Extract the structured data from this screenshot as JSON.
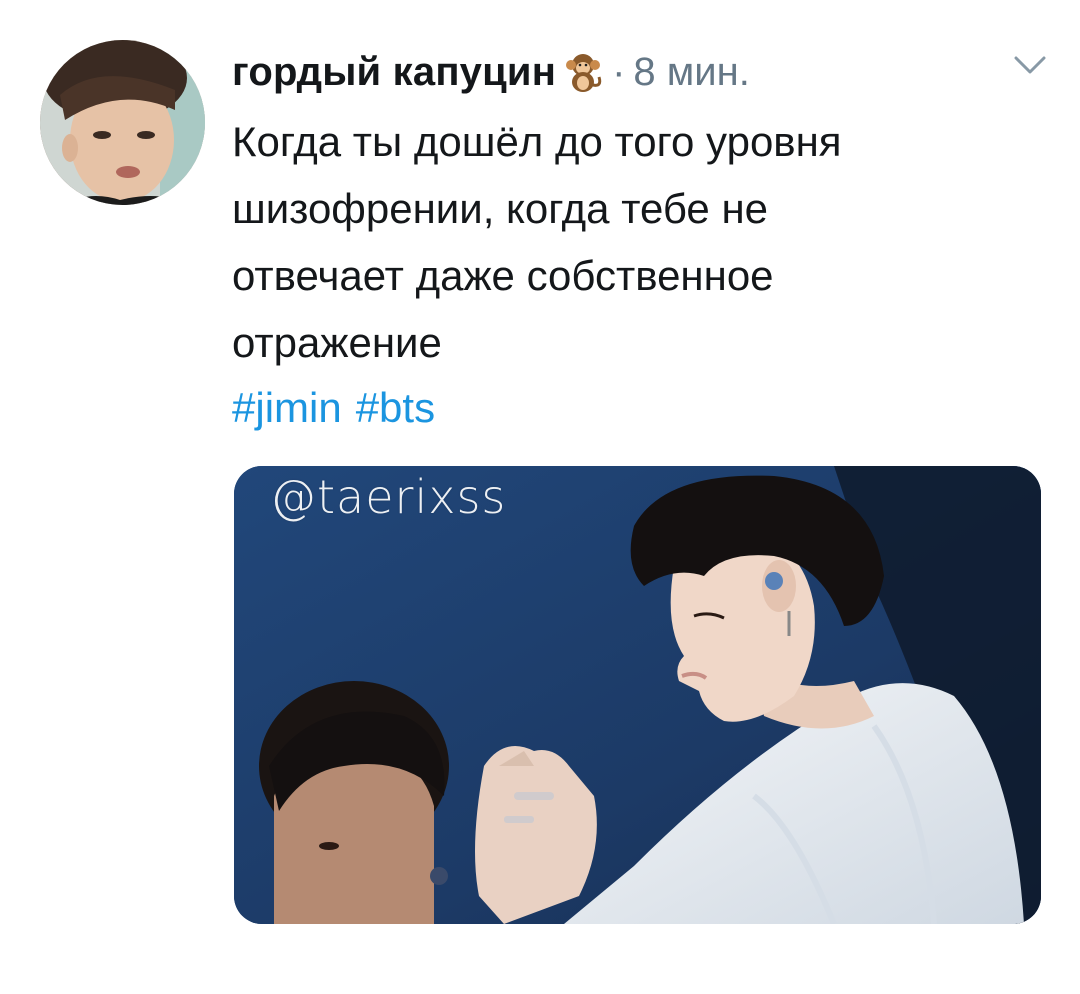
{
  "tweet": {
    "author": {
      "display_name": "гордый капуцин",
      "emoji": "monkey-emoji"
    },
    "separator": "·",
    "timestamp": "8 мин.",
    "text_lines": [
      "Когда ты дошёл до того уровня",
      "шизофрении, когда тебе не",
      "отвечает даже собственное",
      "отражение"
    ],
    "hashtags": [
      "#jimin",
      "#bts"
    ],
    "media": {
      "watermark": "@taerixss"
    }
  },
  "colors": {
    "text": "#14171a",
    "secondary": "#657786",
    "link": "#1b95e0",
    "media_background": "#1e3d68"
  }
}
